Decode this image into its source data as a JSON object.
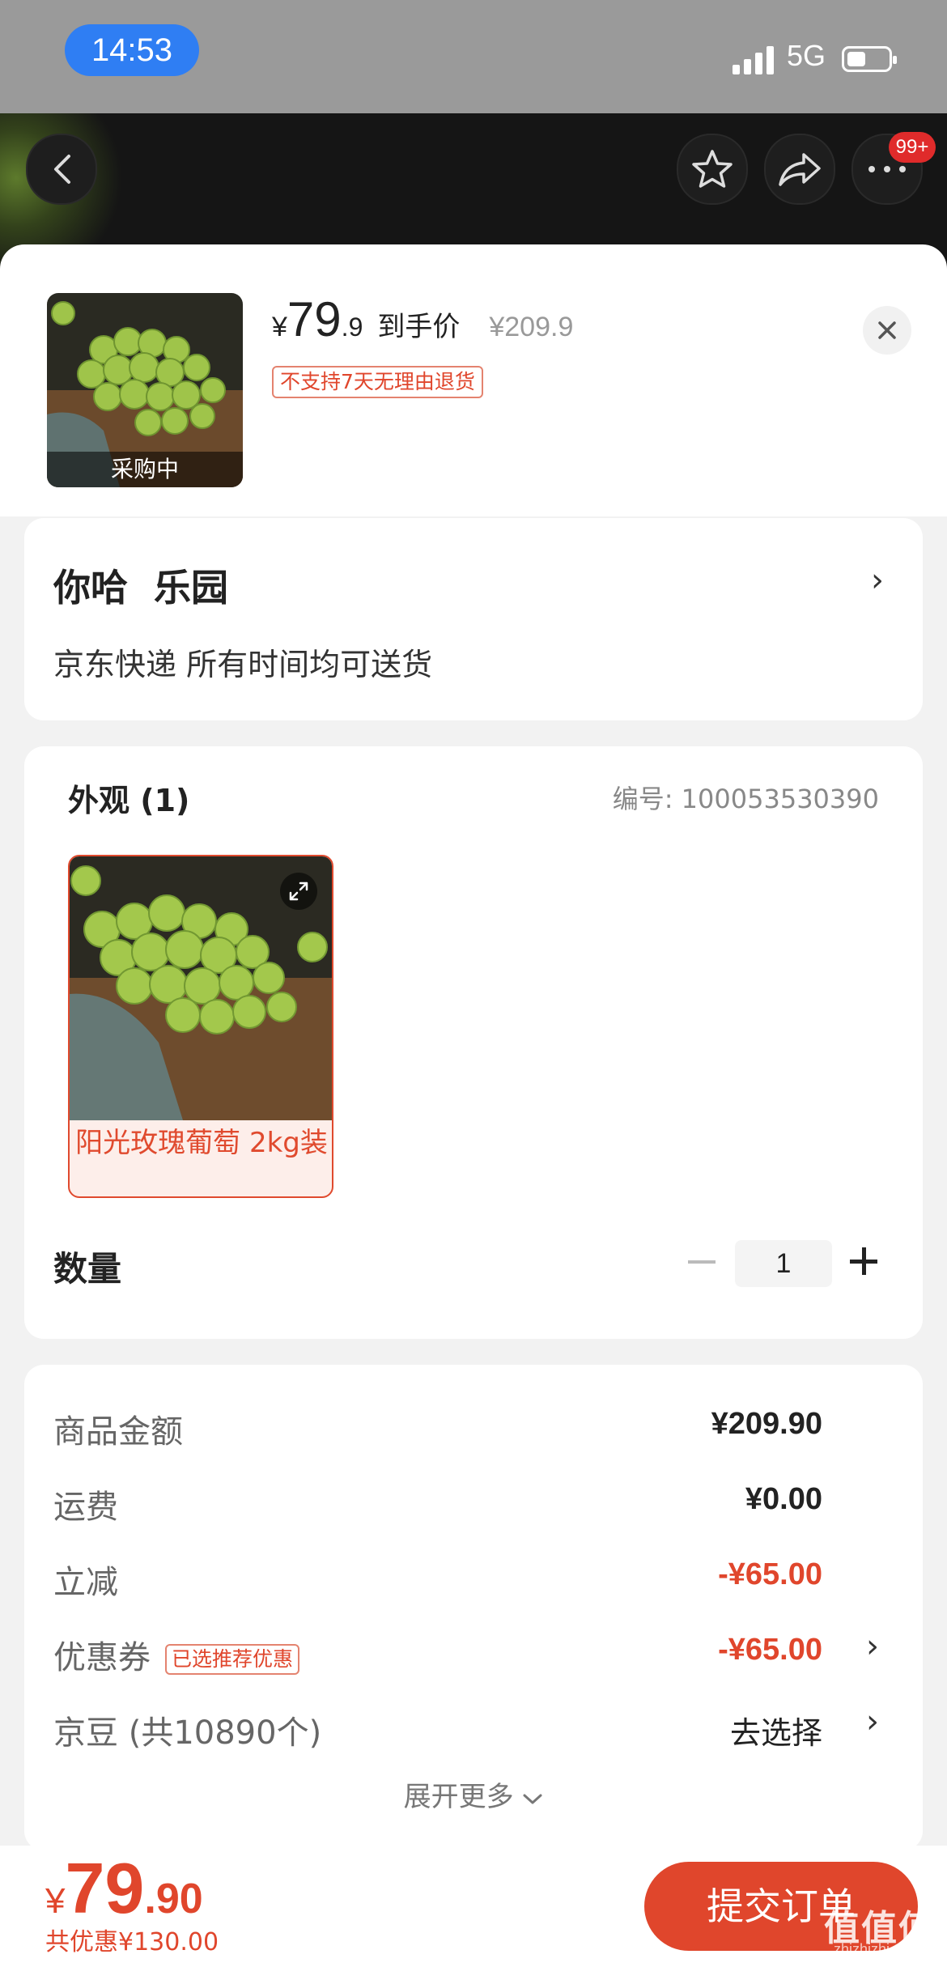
{
  "status_bar": {
    "time": "14:53",
    "network": "5G"
  },
  "header": {
    "more_badge": "99+"
  },
  "product": {
    "thumb_label": "采购中",
    "price_currency": "¥",
    "price_integer": "79",
    "price_decimal": ".9",
    "price_tag": "到手价",
    "original_price": "¥209.9",
    "policy": "不支持7天无理由退货"
  },
  "address": {
    "name": "你哈  乐园",
    "delivery": "京东快递 所有时间均可送货"
  },
  "spec": {
    "title": "外观 (1)",
    "code": "编号: 100053530390",
    "variant_label": "阳光玫瑰葡萄 2kg装",
    "quantity_label": "数量",
    "quantity": "1"
  },
  "costs": {
    "items_label": "商品金额",
    "items_value": "¥209.90",
    "shipping_label": "运费",
    "shipping_value": "¥0.00",
    "discount_label": "立减",
    "discount_value": "-¥65.00",
    "coupon_label": "优惠券",
    "coupon_tag": "已选推荐优惠",
    "coupon_value": "-¥65.00",
    "beans_label": "京豆 (共10890个)",
    "beans_value": "去选择",
    "expand_label": "展开更多"
  },
  "footer": {
    "total_currency": "¥",
    "total_integer": "79",
    "total_decimal": ".90",
    "saving": "共优惠¥130.00",
    "submit_label": "提交订单",
    "watermark": "值值值",
    "watermark_sub": "zhizhizhi.com"
  },
  "colors": {
    "accent": "#e0462c",
    "status_pill": "#2f7ef3"
  },
  "icons": [
    "back-icon",
    "star-icon",
    "share-icon",
    "more-icon",
    "close-icon",
    "expand-icon",
    "chevron-right-icon",
    "chevron-down-icon"
  ]
}
